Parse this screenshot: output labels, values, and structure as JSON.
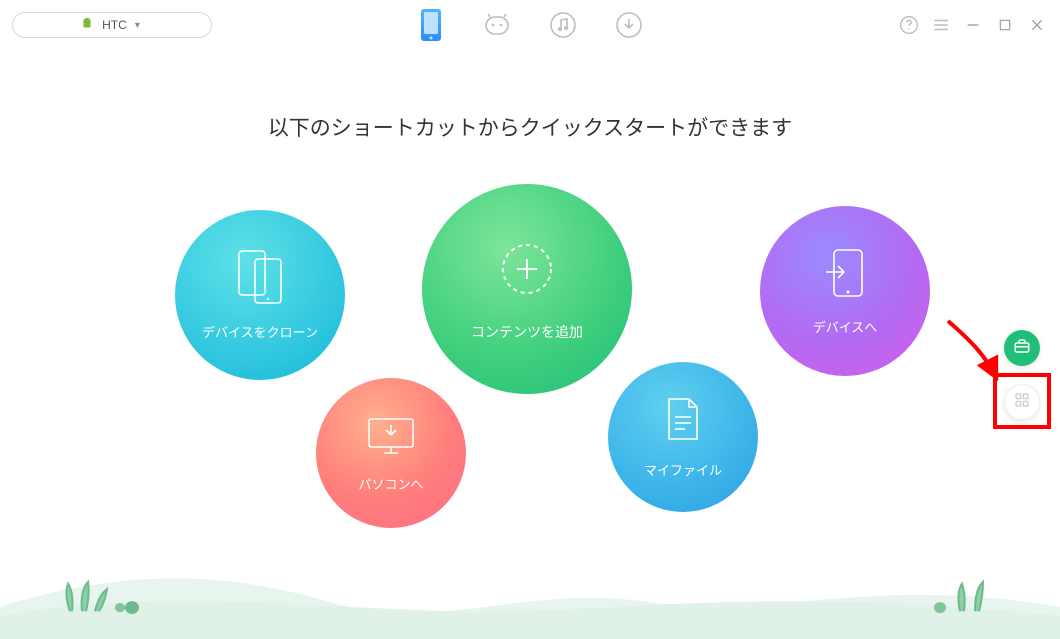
{
  "device": {
    "name": "HTC"
  },
  "heading": "以下のショートカットからクイックスタートができます",
  "shortcuts": {
    "clone": "デバイスをクローン",
    "add": "コンテンツを追加",
    "pc": "パソコンへ",
    "my": "マイファイル",
    "device": "デバイスへ"
  }
}
